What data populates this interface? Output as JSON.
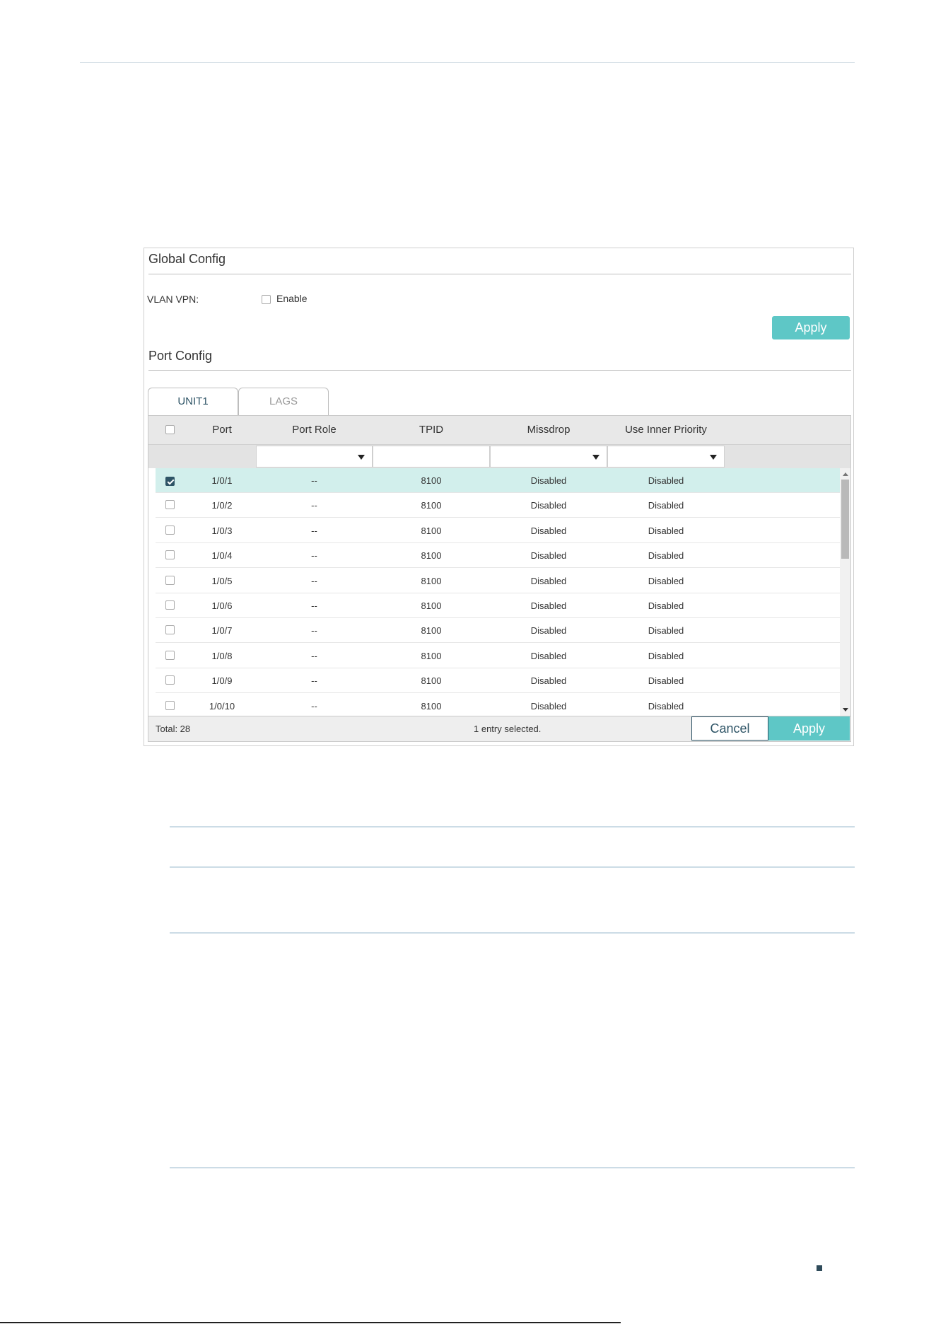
{
  "global_config": {
    "title": "Global Config",
    "vlan_vpn_label": "VLAN VPN:",
    "enable_label": "Enable",
    "enable_checked": false,
    "apply_label": "Apply"
  },
  "port_config": {
    "title": "Port Config",
    "tabs": [
      {
        "label": "UNIT1",
        "active": true
      },
      {
        "label": "LAGS",
        "active": false
      }
    ],
    "columns": [
      "Port",
      "Port Role",
      "TPID",
      "Missdrop",
      "Use Inner Priority"
    ],
    "rows": [
      {
        "port": "1/0/1",
        "role": "--",
        "tpid": "8100",
        "missdrop": "Disabled",
        "inner_priority": "Disabled",
        "checked": true
      },
      {
        "port": "1/0/2",
        "role": "--",
        "tpid": "8100",
        "missdrop": "Disabled",
        "inner_priority": "Disabled",
        "checked": false
      },
      {
        "port": "1/0/3",
        "role": "--",
        "tpid": "8100",
        "missdrop": "Disabled",
        "inner_priority": "Disabled",
        "checked": false
      },
      {
        "port": "1/0/4",
        "role": "--",
        "tpid": "8100",
        "missdrop": "Disabled",
        "inner_priority": "Disabled",
        "checked": false
      },
      {
        "port": "1/0/5",
        "role": "--",
        "tpid": "8100",
        "missdrop": "Disabled",
        "inner_priority": "Disabled",
        "checked": false
      },
      {
        "port": "1/0/6",
        "role": "--",
        "tpid": "8100",
        "missdrop": "Disabled",
        "inner_priority": "Disabled",
        "checked": false
      },
      {
        "port": "1/0/7",
        "role": "--",
        "tpid": "8100",
        "missdrop": "Disabled",
        "inner_priority": "Disabled",
        "checked": false
      },
      {
        "port": "1/0/8",
        "role": "--",
        "tpid": "8100",
        "missdrop": "Disabled",
        "inner_priority": "Disabled",
        "checked": false
      },
      {
        "port": "1/0/9",
        "role": "--",
        "tpid": "8100",
        "missdrop": "Disabled",
        "inner_priority": "Disabled",
        "checked": false
      },
      {
        "port": "1/0/10",
        "role": "--",
        "tpid": "8100",
        "missdrop": "Disabled",
        "inner_priority": "Disabled",
        "checked": false
      }
    ],
    "footer": {
      "total": "Total: 28",
      "selected_info": "1 entry selected.",
      "cancel_label": "Cancel",
      "apply_label": "Apply"
    }
  },
  "colors": {
    "accent": "#5ec7c6",
    "selected_row": "#d2efec",
    "primary_dark": "#2e5466"
  },
  "icons": {
    "dropdown": "chevron-down-icon",
    "checkbox": "checkbox-icon"
  }
}
